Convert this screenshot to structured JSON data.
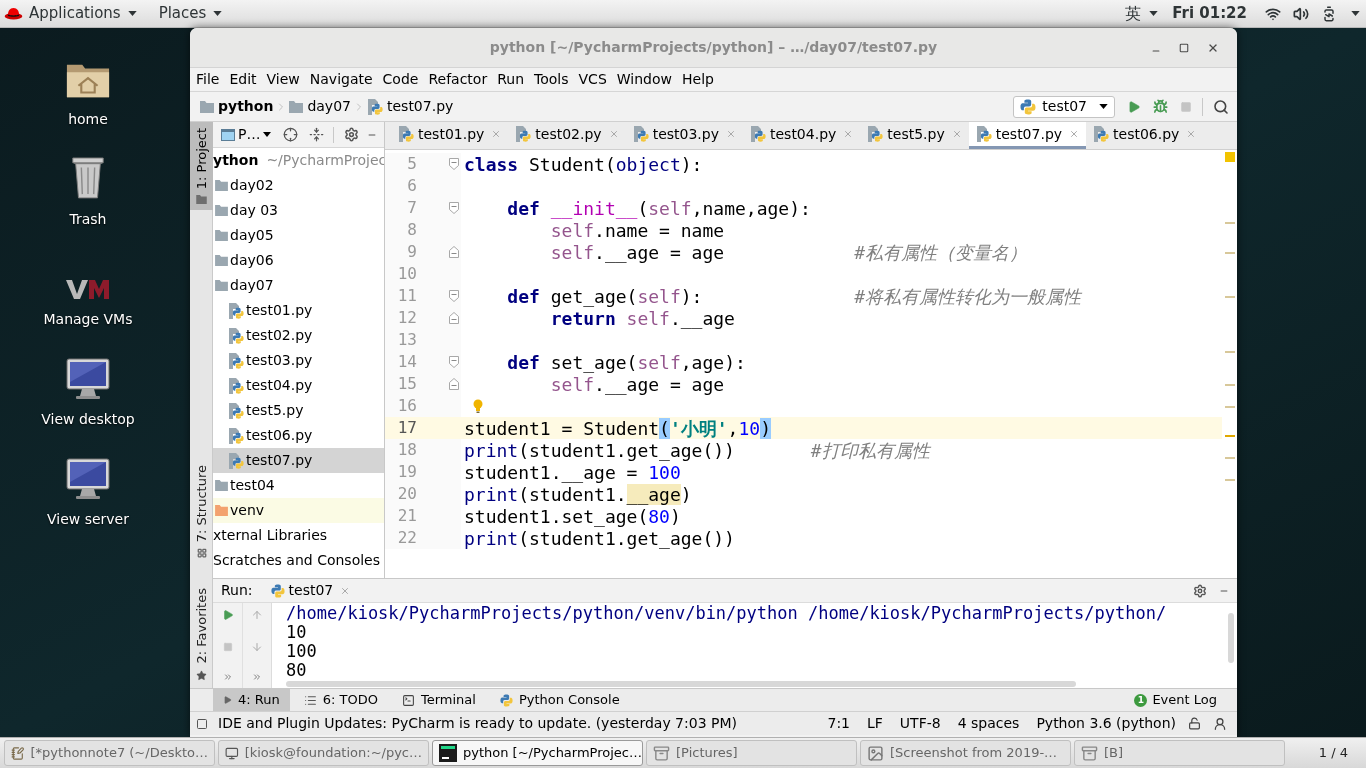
{
  "top_bar": {
    "menus": [
      {
        "label": "Applications"
      },
      {
        "label": "Places"
      }
    ],
    "input_method": "英",
    "clock": "Fri 01:22"
  },
  "desktop_icons": [
    {
      "label": "home",
      "kind": "home"
    },
    {
      "label": "Trash",
      "kind": "trash"
    },
    {
      "label": "Manage VMs",
      "kind": "vm"
    },
    {
      "label": "View desktop",
      "kind": "monitor"
    },
    {
      "label": "View server",
      "kind": "monitor"
    }
  ],
  "window": {
    "title": "python [~/PycharmProjects/python] – …/day07/test07.py"
  },
  "menu_bar": [
    "File",
    "Edit",
    "View",
    "Navigate",
    "Code",
    "Refactor",
    "Run",
    "Tools",
    "VCS",
    "Window",
    "Help"
  ],
  "navigation_bar": {
    "breadcrumb": [
      {
        "label": "python",
        "kind": "project"
      },
      {
        "label": "day07",
        "kind": "folder"
      },
      {
        "label": "test07.py",
        "kind": "file"
      }
    ],
    "run_config": "test07",
    "actions": [
      {
        "kind": "run",
        "disabled": false
      },
      {
        "kind": "debug",
        "disabled": false
      },
      {
        "kind": "stop",
        "disabled": true
      }
    ]
  },
  "tool_stripes": {
    "top": [
      {
        "label": "1: Project",
        "selected": true
      }
    ],
    "bottom": [
      {
        "label": "7: Structure",
        "selected": false
      }
    ],
    "run_area": [
      {
        "label": "2: Favorites",
        "selected": false
      }
    ]
  },
  "project": {
    "view": "P…",
    "tree": [
      {
        "label": "ython",
        "path": "~/PycharmProjec",
        "kind": "root",
        "selected": false,
        "children": [
          {
            "label": "day02",
            "kind": "folder",
            "selected": false
          },
          {
            "label": "day 03",
            "kind": "folder",
            "selected": false
          },
          {
            "label": "day05",
            "kind": "folder",
            "selected": false
          },
          {
            "label": "day06",
            "kind": "folder",
            "selected": false
          },
          {
            "label": "day07",
            "kind": "folder",
            "selected": false,
            "children": [
              {
                "label": "test01.py",
                "kind": "file",
                "selected": false
              },
              {
                "label": "test02.py",
                "kind": "file",
                "selected": false
              },
              {
                "label": "test03.py",
                "kind": "file",
                "selected": false
              },
              {
                "label": "test04.py",
                "kind": "file",
                "selected": false
              },
              {
                "label": "test5.py",
                "kind": "file",
                "selected": false
              },
              {
                "label": "test06.py",
                "kind": "file",
                "selected": false
              },
              {
                "label": "test07.py",
                "kind": "file",
                "selected": true
              }
            ]
          },
          {
            "label": "test04",
            "kind": "folder",
            "selected": false
          },
          {
            "label": "venv",
            "kind": "excluded",
            "selected": false
          }
        ]
      },
      {
        "label": "xternal Libraries",
        "kind": "plain",
        "selected": false
      },
      {
        "label": "Scratches and Consoles",
        "kind": "plain",
        "selected": false
      }
    ]
  },
  "editor_tabs": [
    {
      "label": "test01.py",
      "selected": false
    },
    {
      "label": "test02.py",
      "selected": false
    },
    {
      "label": "test03.py",
      "selected": false
    },
    {
      "label": "test04.py",
      "selected": false
    },
    {
      "label": "test5.py",
      "selected": false
    },
    {
      "label": "test07.py",
      "selected": true
    },
    {
      "label": "test06.py",
      "selected": false
    }
  ],
  "editor": {
    "lines": [
      {
        "number": "5",
        "kind": "fold_start",
        "current": false,
        "tokens": [
          {
            "kind": "keyword",
            "text": "class"
          },
          {
            "kind": "plain",
            "text": " Student("
          },
          {
            "kind": "builtin",
            "text": "object"
          },
          {
            "kind": "plain",
            "text": "):"
          }
        ]
      },
      {
        "number": "6",
        "kind": "plain",
        "current": false
      },
      {
        "number": "7",
        "kind": "fold_start",
        "current": false,
        "tokens": [
          {
            "kind": "keyword",
            "text": "    def "
          },
          {
            "kind": "magic",
            "text": "__init__"
          },
          {
            "kind": "plain",
            "text": "("
          },
          {
            "kind": "self",
            "text": "self"
          },
          {
            "kind": "plain",
            "text": ",name,age):"
          }
        ]
      },
      {
        "number": "8",
        "kind": "plain",
        "current": false,
        "tokens": [
          {
            "kind": "self",
            "text": "        self"
          },
          {
            "kind": "plain",
            "text": ".name = name"
          }
        ]
      },
      {
        "number": "9",
        "kind": "fold_end",
        "current": false,
        "tokens": [
          {
            "kind": "self",
            "text": "        self"
          },
          {
            "kind": "plain",
            "text": ".__age = age            "
          },
          {
            "kind": "comment",
            "text": "#私有属性（变量名）"
          }
        ]
      },
      {
        "number": "10",
        "kind": "plain",
        "current": false
      },
      {
        "number": "11",
        "kind": "fold_start",
        "current": false,
        "tokens": [
          {
            "kind": "keyword",
            "text": "    def"
          },
          {
            "kind": "plain",
            "text": " get_age("
          },
          {
            "kind": "self",
            "text": "self"
          },
          {
            "kind": "plain",
            "text": "):              "
          },
          {
            "kind": "comment",
            "text": "#将私有属性转化为一般属性"
          }
        ]
      },
      {
        "number": "12",
        "kind": "fold_end",
        "current": false,
        "tokens": [
          {
            "kind": "keyword",
            "text": "        return "
          },
          {
            "kind": "self",
            "text": "self"
          },
          {
            "kind": "plain",
            "text": ".__age"
          }
        ]
      },
      {
        "number": "13",
        "kind": "plain",
        "current": false
      },
      {
        "number": "14",
        "kind": "fold_start",
        "current": false,
        "tokens": [
          {
            "kind": "keyword",
            "text": "    def"
          },
          {
            "kind": "plain",
            "text": " set_age("
          },
          {
            "kind": "self",
            "text": "self"
          },
          {
            "kind": "plain",
            "text": ",age):"
          }
        ]
      },
      {
        "number": "15",
        "kind": "fold_end",
        "current": false,
        "tokens": [
          {
            "kind": "self",
            "text": "        self"
          },
          {
            "kind": "plain",
            "text": ".__age = age"
          }
        ]
      },
      {
        "number": "16",
        "kind": "bulb",
        "current": false
      },
      {
        "number": "17",
        "kind": "plain",
        "current": true,
        "tokens": [
          {
            "kind": "plain",
            "text": "student1 = Student"
          },
          {
            "kind": "match",
            "text": "("
          },
          {
            "kind": "string",
            "text": "'小明'"
          },
          {
            "kind": "plain",
            "text": ","
          },
          {
            "kind": "number",
            "text": "10"
          },
          {
            "kind": "match",
            "text": ")"
          }
        ]
      },
      {
        "number": "18",
        "kind": "plain",
        "current": false,
        "tokens": [
          {
            "kind": "builtin",
            "text": "print"
          },
          {
            "kind": "plain",
            "text": "(student1.get_age())       "
          },
          {
            "kind": "comment",
            "text": "#打印私有属性"
          }
        ]
      },
      {
        "number": "19",
        "kind": "plain",
        "current": false,
        "tokens": [
          {
            "kind": "plain",
            "text": "student1.__age = "
          },
          {
            "kind": "number",
            "text": "100"
          }
        ]
      },
      {
        "number": "20",
        "kind": "plain",
        "current": false,
        "tokens": [
          {
            "kind": "builtin",
            "text": "print"
          },
          {
            "kind": "plain",
            "text": "(student1."
          },
          {
            "kind": "warning",
            "text": "__age"
          },
          {
            "kind": "plain",
            "text": ")"
          }
        ]
      },
      {
        "number": "21",
        "kind": "plain",
        "current": false,
        "tokens": [
          {
            "kind": "plain",
            "text": "student1.set_age("
          },
          {
            "kind": "number",
            "text": "80"
          },
          {
            "kind": "plain",
            "text": ")"
          }
        ]
      },
      {
        "number": "22",
        "kind": "plain",
        "current": false,
        "tokens": [
          {
            "kind": "builtin",
            "text": "print"
          },
          {
            "kind": "plain",
            "text": "(student1.get_age())"
          }
        ]
      }
    ]
  },
  "run_panel": {
    "label": "Run:",
    "tab": "test07",
    "output": [
      {
        "kind": "command",
        "text": "/home/kiosk/PycharmProjects/python/venv/bin/python /home/kiosk/PycharmProjects/python/"
      },
      {
        "kind": "stdout",
        "text": "10"
      },
      {
        "kind": "stdout",
        "text": "100"
      },
      {
        "kind": "stdout",
        "text": "80"
      }
    ]
  },
  "tool_windows": [
    {
      "label": "4: Run",
      "kind": "run",
      "selected": true
    },
    {
      "label": "6: TODO",
      "kind": "todo",
      "selected": false
    },
    {
      "label": "Terminal",
      "kind": "terminal",
      "selected": false
    },
    {
      "label": "Python Console",
      "kind": "console",
      "selected": false
    }
  ],
  "event_log": {
    "label": "Event Log",
    "count": "1"
  },
  "status_bar": {
    "message": "IDE and Plugin Updates: PyCharm is ready to update. (yesterday 7:03 PM)",
    "items": [
      "7:1",
      "LF",
      "UTF-8",
      "4 spaces",
      "Python 3.6 (python)"
    ]
  },
  "taskbar": {
    "items": [
      {
        "label": "[*pythonnote7 (~/Deskto…",
        "kind": "editor",
        "selected": false
      },
      {
        "label": "[kiosk@foundation:~/pyc…",
        "kind": "terminal",
        "selected": false
      },
      {
        "label": "python [~/PycharmProjec…",
        "kind": "ide",
        "selected": true
      },
      {
        "label": "[Pictures]",
        "kind": "files",
        "selected": false
      },
      {
        "label": "[Screenshot from 2019-…",
        "kind": "image",
        "selected": false
      },
      {
        "label": "[B]",
        "kind": "files",
        "selected": false
      }
    ],
    "workspace": "1 / 4"
  }
}
